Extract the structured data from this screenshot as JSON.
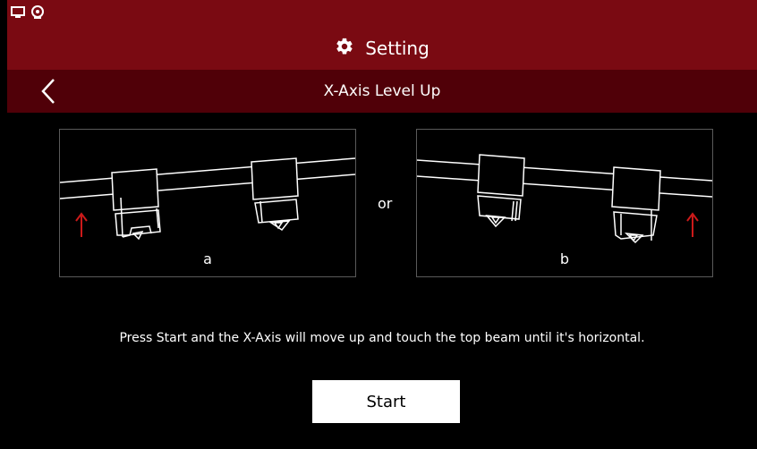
{
  "statusbar": {
    "icons": [
      "monitor-icon",
      "webcam-icon"
    ]
  },
  "header": {
    "title": "Setting",
    "icon": "gear-icon"
  },
  "subheader": {
    "title": "X-Axis Level Up",
    "back_icon": "chevron-left-icon"
  },
  "panels": [
    {
      "label": "a",
      "arrow_side": "left",
      "arrow_color": "#cc1a1a"
    },
    {
      "label": "b",
      "arrow_side": "right",
      "arrow_color": "#cc1a1a"
    }
  ],
  "separator": "or",
  "instruction": "Press Start and the X-Axis will move up and touch the top beam until it's horizontal.",
  "start_button": {
    "label": "Start"
  },
  "colors": {
    "header_bg": "#7a0a12",
    "subheader_bg": "#500008",
    "accent_red": "#cc1a1a"
  }
}
